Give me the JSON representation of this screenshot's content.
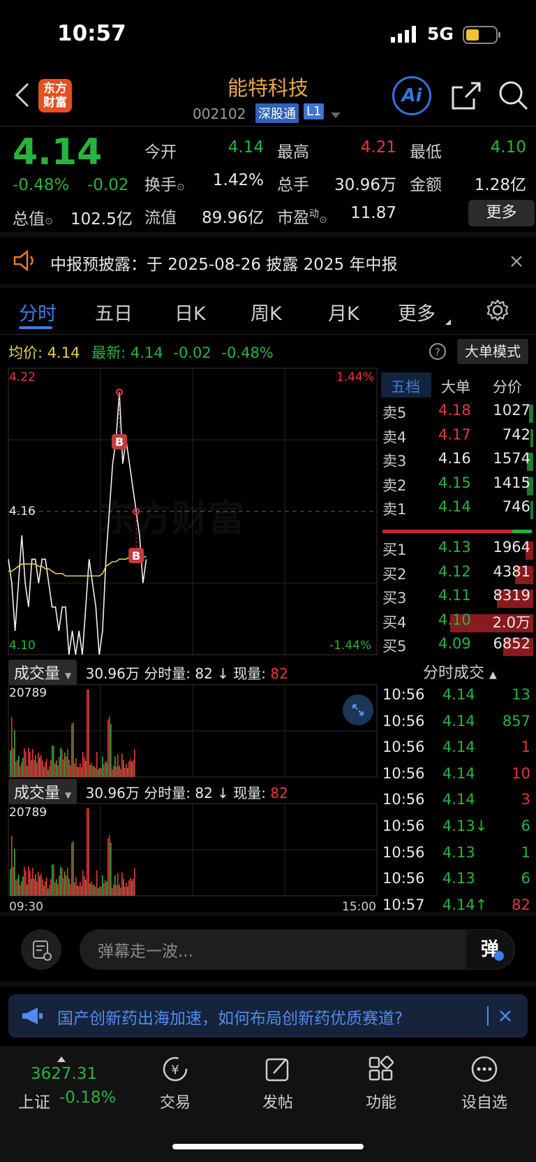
{
  "status_bar": {
    "time": "10:57",
    "network": "5G"
  },
  "header": {
    "back_icon": "chevron-left-icon",
    "logo_text": "东方\n财富",
    "title": "能特科技",
    "code": "002102",
    "tag_connect": "深股通",
    "tag_level": "L1",
    "ai_label": "Ai",
    "share_icon": "share-icon",
    "search_icon": "search-icon"
  },
  "quote": {
    "price": "4.14",
    "change_pct": "-0.48%",
    "change": "-0.02",
    "open_label": "今开",
    "open": "4.14",
    "high_label": "最高",
    "high": "4.21",
    "low_label": "最低",
    "low": "4.10",
    "turnover_label": "换手",
    "turnover": "1.42%",
    "volume_label": "总手",
    "volume": "30.96万",
    "amount_label": "金额",
    "amount": "1.28亿",
    "mktcap_label": "总值",
    "mktcap": "102.5亿",
    "float_label": "流值",
    "float": "89.96亿",
    "pe_label": "市盈",
    "pe_sup": "动",
    "pe": "11.87",
    "more_label": "更多"
  },
  "notice": {
    "icon": "speaker-icon",
    "text": "中报预披露：于 2025-08-26 披露 2025 年中报"
  },
  "tabs": [
    "分时",
    "五日",
    "日K",
    "周K",
    "月K",
    "更多"
  ],
  "info_line": {
    "avg_label": "均价:",
    "avg": "4.14",
    "latest_label": "最新:",
    "latest": "4.14",
    "change": "-0.02",
    "change_pct": "-0.48%",
    "mode_label": "大单模式"
  },
  "chart": {
    "price_top": "4.22",
    "price_mid": "4.16",
    "price_bottom": "4.10",
    "pct_top": "1.44%",
    "pct_bottom": "-1.44%",
    "watermark": "东方财富",
    "marker_label": "B",
    "vol_max": "20789",
    "time_start": "09:30",
    "time_end": "15:00",
    "vol_header": {
      "select_label": "成交量",
      "total": "30.96万",
      "fen_label": "分时量:",
      "fen_val": "82",
      "now_label": "现量:",
      "now_val": "82"
    }
  },
  "chart_data": {
    "type": "line",
    "series": [
      {
        "name": "",
        "values": [
          4.14,
          4.13,
          4.11,
          4.13,
          4.15,
          4.13,
          4.12,
          4.14,
          4.14,
          4.13,
          4.14,
          4.14,
          4.13,
          4.12,
          4.12,
          4.11,
          4.12,
          4.12,
          4.1,
          4.11,
          4.1,
          4.11,
          4.1,
          4.12,
          4.14,
          4.13,
          4.12,
          4.1,
          4.11,
          4.14,
          4.16,
          4.18,
          4.19,
          4.21,
          4.18,
          4.19,
          4.18,
          4.17,
          4.16,
          4.15,
          4.13,
          4.14
        ]
      },
      {
        "name": "均价",
        "values": [
          4.135,
          4.135,
          4.136,
          4.137,
          4.138,
          4.138,
          4.138,
          4.138,
          4.138,
          4.137,
          4.137,
          4.136,
          4.136,
          4.135,
          4.134,
          4.134,
          4.134,
          4.133,
          4.133,
          4.133,
          4.133,
          4.133,
          4.133,
          4.133,
          4.133,
          4.133,
          4.133,
          4.133,
          4.134,
          4.137,
          4.138,
          4.139,
          4.139,
          4.14,
          4.14,
          4.14,
          4.141,
          4.141,
          4.141,
          4.141,
          4.141,
          4.141
        ]
      }
    ],
    "ylim": [
      4.1,
      4.22
    ]
  },
  "order_book": {
    "headers": [
      "五档",
      "大单",
      "分价"
    ],
    "asks": [
      {
        "label": "卖5",
        "price": "4.18",
        "vol": "1027",
        "color": "red",
        "bar": 0.03
      },
      {
        "label": "卖4",
        "price": "4.17",
        "vol": "742",
        "color": "red",
        "bar": 0.02
      },
      {
        "label": "卖3",
        "price": "4.16",
        "vol": "1574",
        "color": "white",
        "bar": 0.04
      },
      {
        "label": "卖2",
        "price": "4.15",
        "vol": "1415",
        "color": "green",
        "bar": 0.04
      },
      {
        "label": "卖1",
        "price": "4.14",
        "vol": "746",
        "color": "green",
        "bar": 0.02
      }
    ],
    "bids": [
      {
        "label": "买1",
        "price": "4.13",
        "vol": "1964",
        "color": "green",
        "bar": 0.05
      },
      {
        "label": "买2",
        "price": "4.12",
        "vol": "4381",
        "color": "green",
        "bar": 0.12
      },
      {
        "label": "买3",
        "price": "4.11",
        "vol": "8319",
        "color": "green",
        "bar": 0.24
      },
      {
        "label": "买4",
        "price": "4.10",
        "vol": "2.0万",
        "color": "green",
        "bar": 0.55
      },
      {
        "label": "买5",
        "price": "4.09",
        "vol": "6852",
        "color": "green",
        "bar": 0.2
      }
    ]
  },
  "trades": {
    "header": "分时成交",
    "rows": [
      {
        "time": "10:56",
        "price": "4.14",
        "vol": "13",
        "vcolor": "green"
      },
      {
        "time": "10:56",
        "price": "4.14",
        "vol": "857",
        "vcolor": "green"
      },
      {
        "time": "10:56",
        "price": "4.14",
        "vol": "1",
        "vcolor": "red"
      },
      {
        "time": "10:56",
        "price": "4.14",
        "vol": "10",
        "vcolor": "red"
      },
      {
        "time": "10:56",
        "price": "4.14",
        "vol": "3",
        "vcolor": "red"
      },
      {
        "time": "10:56",
        "price": "4.13↓",
        "vol": "6",
        "vcolor": "green"
      },
      {
        "time": "10:56",
        "price": "4.13",
        "vol": "1",
        "vcolor": "green"
      },
      {
        "time": "10:56",
        "price": "4.13",
        "vol": "6",
        "vcolor": "green"
      },
      {
        "time": "10:57",
        "price": "4.14↑",
        "vol": "82",
        "vcolor": "red"
      }
    ]
  },
  "comment": {
    "placeholder": "弹幕走一波...",
    "danmu_label": "弹"
  },
  "banner": {
    "text": "国产创新药出海加速，如何布局创新药优质赛道?"
  },
  "bottom_nav": {
    "index_value": "3627.31",
    "index_name": "上证",
    "index_change": "-0.18%",
    "items": [
      {
        "label": "交易",
        "icon": "yen-exchange-icon"
      },
      {
        "label": "发帖",
        "icon": "edit-icon"
      },
      {
        "label": "功能",
        "icon": "grid-icon"
      },
      {
        "label": "设自选",
        "icon": "more-dots-icon"
      }
    ]
  },
  "colors": {
    "up": "#e8363a",
    "down": "#25b53f",
    "avg": "#e6d04a",
    "accent": "#3a7ee8",
    "brand": "#e8a64a"
  }
}
